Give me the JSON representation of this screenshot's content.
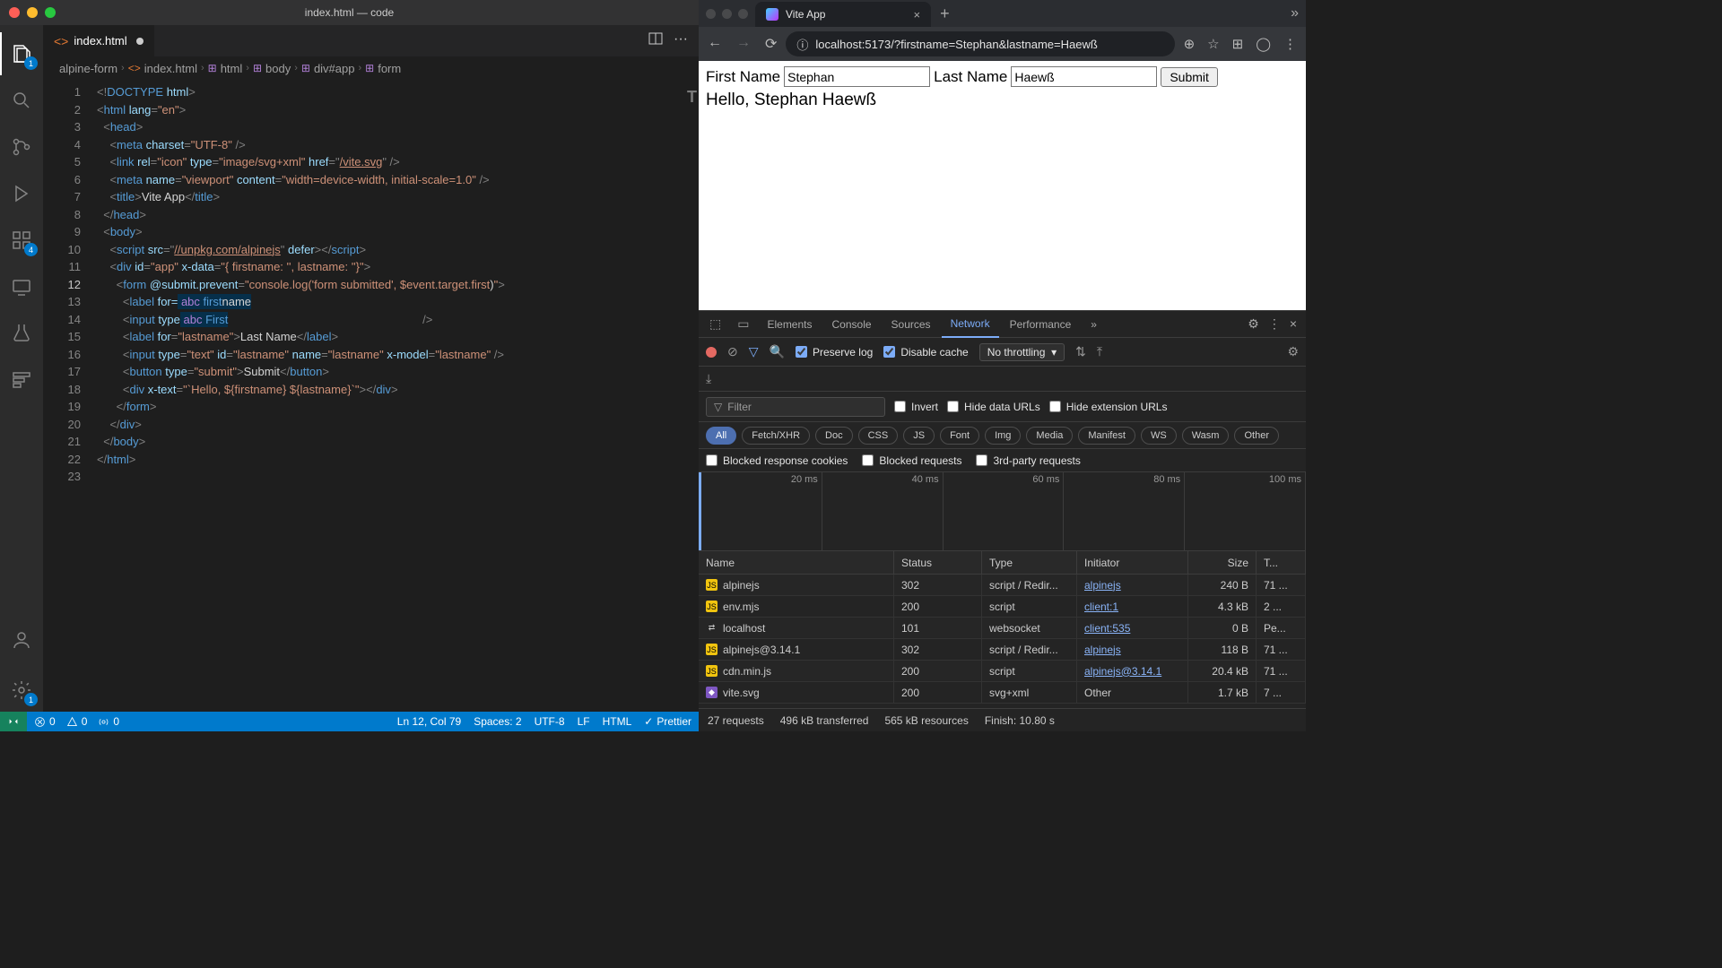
{
  "vscode": {
    "title": "index.html — code",
    "tab_filename": "index.html",
    "breadcrumb": [
      "alpine-form",
      "index.html",
      "html",
      "body",
      "div#app",
      "form"
    ],
    "lines": [
      "1",
      "2",
      "3",
      "4",
      "5",
      "6",
      "7",
      "8",
      "9",
      "10",
      "11",
      "12",
      "13",
      "14",
      "15",
      "16",
      "17",
      "18",
      "19",
      "20",
      "21",
      "22",
      "23"
    ],
    "current_line_index": 11,
    "suggestion1": "firstname",
    "suggestion2": "First",
    "statusbar": {
      "errors": "0",
      "warnings": "0",
      "broadcast": "0",
      "cursor": "Ln 12, Col 79",
      "spaces": "Spaces: 2",
      "encoding": "UTF-8",
      "eol": "LF",
      "lang": "HTML",
      "prettier": "Prettier"
    }
  },
  "browser": {
    "tab_title": "Vite App",
    "url": "localhost:5173/?firstname=Stephan&lastname=Haewß",
    "page": {
      "first_label": "First Name",
      "first_value": "Stephan",
      "last_label": "Last Name",
      "last_value": "Haewß",
      "submit": "Submit",
      "greeting": "Hello, Stephan Haewß"
    }
  },
  "devtools": {
    "tabs": [
      "Elements",
      "Console",
      "Sources",
      "Network",
      "Performance"
    ],
    "active_tab": "Network",
    "more": "»",
    "preserve_log": "Preserve log",
    "disable_cache": "Disable cache",
    "throttling": "No throttling",
    "filter_placeholder": "Filter",
    "invert": "Invert",
    "hide_data": "Hide data URLs",
    "hide_ext": "Hide extension URLs",
    "chips": [
      "All",
      "Fetch/XHR",
      "Doc",
      "CSS",
      "JS",
      "Font",
      "Img",
      "Media",
      "Manifest",
      "WS",
      "Wasm",
      "Other"
    ],
    "blocked_cookies": "Blocked response cookies",
    "blocked_requests": "Blocked requests",
    "third_party": "3rd-party requests",
    "timeline": [
      "20 ms",
      "40 ms",
      "60 ms",
      "80 ms",
      "100 ms"
    ],
    "columns": [
      "Name",
      "Status",
      "Type",
      "Initiator",
      "Size",
      "T..."
    ],
    "rows": [
      {
        "icon": "js",
        "name": "alpinejs",
        "status": "302",
        "type": "script / Redir...",
        "init": "alpinejs",
        "init_link": true,
        "size": "240 B",
        "time": "71 ..."
      },
      {
        "icon": "js",
        "name": "env.mjs",
        "status": "200",
        "type": "script",
        "init": "client:1",
        "init_link": true,
        "size": "4.3 kB",
        "time": "2 ..."
      },
      {
        "icon": "ws",
        "name": "localhost",
        "status": "101",
        "type": "websocket",
        "init": "client:535",
        "init_link": true,
        "size": "0 B",
        "time": "Pe..."
      },
      {
        "icon": "js",
        "name": "alpinejs@3.14.1",
        "status": "302",
        "type": "script / Redir...",
        "init": "alpinejs",
        "init_link": true,
        "size": "118 B",
        "time": "71 ..."
      },
      {
        "icon": "js",
        "name": "cdn.min.js",
        "status": "200",
        "type": "script",
        "init": "alpinejs@3.14.1",
        "init_link": true,
        "size": "20.4 kB",
        "time": "71 ..."
      },
      {
        "icon": "img",
        "name": "vite.svg",
        "status": "200",
        "type": "svg+xml",
        "init": "Other",
        "init_link": false,
        "size": "1.7 kB",
        "time": "7 ..."
      }
    ],
    "footer": {
      "requests": "27 requests",
      "transferred": "496 kB transferred",
      "resources": "565 kB resources",
      "finish": "Finish: 10.80 s"
    }
  },
  "chart_data": {
    "type": "table",
    "title": "Network requests",
    "columns": [
      "Name",
      "Status",
      "Type",
      "Initiator",
      "Size",
      "Time"
    ],
    "rows": [
      [
        "alpinejs",
        "302",
        "script / Redirect",
        "alpinejs",
        "240 B",
        "71 ms"
      ],
      [
        "env.mjs",
        "200",
        "script",
        "client:1",
        "4.3 kB",
        "2 ms"
      ],
      [
        "localhost",
        "101",
        "websocket",
        "client:535",
        "0 B",
        "Pending"
      ],
      [
        "alpinejs@3.14.1",
        "302",
        "script / Redirect",
        "alpinejs",
        "118 B",
        "71 ms"
      ],
      [
        "cdn.min.js",
        "200",
        "script",
        "alpinejs@3.14.1",
        "20.4 kB",
        "71 ms"
      ],
      [
        "vite.svg",
        "200",
        "svg+xml",
        "Other",
        "1.7 kB",
        "7 ms"
      ]
    ]
  }
}
